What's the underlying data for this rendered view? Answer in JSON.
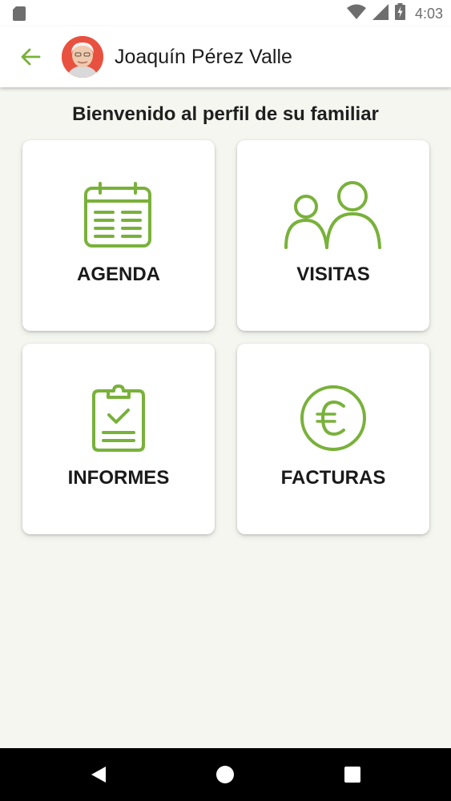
{
  "status_bar": {
    "time": "4:03",
    "icons": [
      "sd-card-icon",
      "wifi-icon",
      "signal-icon",
      "battery-charging-icon"
    ]
  },
  "header": {
    "back_icon": "arrow-back-icon",
    "avatar": "profile-photo",
    "title": "Joaquín Pérez Valle"
  },
  "welcome_text": "Bienvenido al perfil de su familiar",
  "cards": [
    {
      "label": "AGENDA",
      "icon": "calendar-icon"
    },
    {
      "label": "VISITAS",
      "icon": "people-icon"
    },
    {
      "label": "INFORMES",
      "icon": "clipboard-check-icon"
    },
    {
      "label": "FACTURAS",
      "icon": "euro-icon"
    }
  ],
  "nav_bar": [
    "back-triangle-icon",
    "home-circle-icon",
    "recents-square-icon"
  ],
  "colors": {
    "accent": "#79b13a",
    "background": "#f5f6f0",
    "card": "#ffffff",
    "text": "#1a1a1a"
  }
}
